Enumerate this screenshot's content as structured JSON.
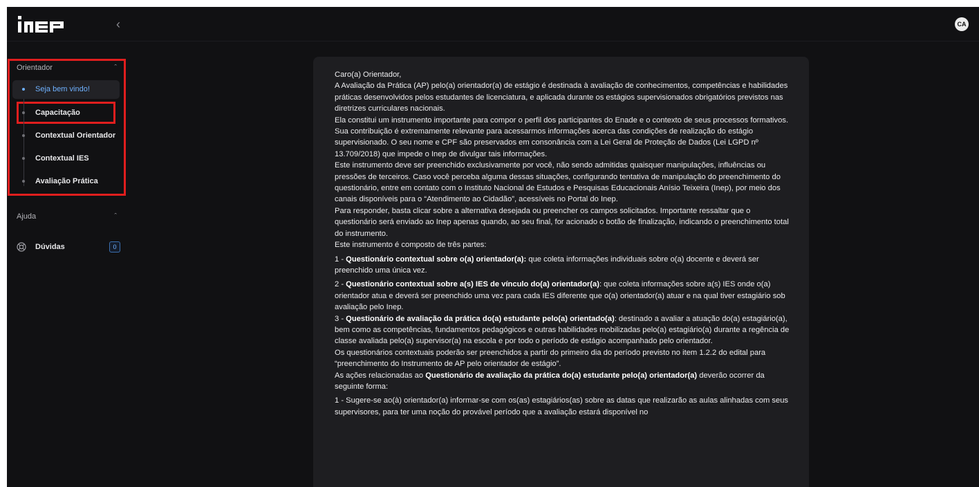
{
  "header": {
    "logo_text": "inep",
    "avatar_initials": "CA"
  },
  "sidebar": {
    "sections": [
      {
        "title": "Orientador",
        "items": [
          {
            "label": "Seja bem vindo!",
            "active": true
          },
          {
            "label": "Capacitação"
          },
          {
            "label": "Contextual Orientador"
          },
          {
            "label": "Contextual IES"
          },
          {
            "label": "Avaliação Prática"
          }
        ]
      },
      {
        "title": "Ajuda",
        "items": [
          {
            "label": "Dúvidas",
            "badge": "0",
            "icon": "help-circle-icon"
          }
        ]
      }
    ]
  },
  "highlight_color": "#e01e1e",
  "accent_color": "#6fb1ff",
  "content": {
    "greeting": "Caro(a) Orientador,",
    "p1": "A Avaliação da Prática (AP) pelo(a) orientador(a) de estágio é destinada à avaliação de conhecimentos, competências e habilidades práticas desenvolvidos pelos estudantes de licenciatura, e aplicada durante os estágios supervisionados obrigatórios previstos nas diretrizes curriculares nacionais.",
    "p2": "Ela constitui um instrumento importante para compor o perfil dos participantes do Enade e o contexto de seus processos formativos.",
    "p3": "Sua contribuição é extremamente relevante para acessarmos informações acerca das condições de realização do estágio supervisionado. O seu nome e CPF são preservados em consonância com a Lei Geral de Proteção de Dados (Lei LGPD nº 13.709/2018) que impede o Inep de divulgar tais informações.",
    "p4": "Este instrumento deve ser preenchido exclusivamente por você, não sendo admitidas quaisquer manipulações, influências ou pressões de terceiros. Caso você perceba alguma dessas situações, configurando tentativa de manipulação do preenchimento do questionário, entre em contato com o Instituto Nacional de Estudos e Pesquisas Educacionais Anísio Teixeira (Inep), por meio dos canais disponíveis para o “Atendimento ao Cidadão”, acessíveis no Portal do Inep.",
    "p5": "Para responder, basta clicar sobre a alternativa desejada ou preencher os campos solicitados. Importante ressaltar que o questionário será enviado ao Inep apenas quando, ao seu final, for acionado o botão de finalização, indicando o preenchimento total do instrumento.",
    "p6": "Este instrumento é composto de três partes:",
    "part1_prefix": "1 - ",
    "part1_bold": "Questionário contextual sobre o(a) orientador(a):",
    "part1_text": " que coleta informações individuais sobre o(a) docente e deverá ser preenchido uma única vez.",
    "part2_prefix": "2 - ",
    "part2_bold": "Questionário contextual sobre a(s) IES de vínculo do(a) orientador(a)",
    "part2_text": ": que coleta informações sobre a(s) IES onde o(a) orientador atua e deverá ser preenchido uma vez para cada IES diferente que o(a) orientador(a) atuar e na qual tiver estagiário sob avaliação pelo Inep.",
    "part3_prefix": "3 - ",
    "part3_bold": "Questionário de avaliação da prática do(a) estudante pelo(a) orientado(a)",
    "part3_text": ": destinado a avaliar a atuação do(a) estagiário(a), bem como as competências, fundamentos pedagógicos e outras habilidades mobilizadas pelo(a) estagiário(a) durante a regência de classe avaliada pelo(a) supervisor(a) na escola e por todo o período de estágio acompanhado pelo orientador.",
    "p7": "Os questionários contextuais poderão ser preenchidos a partir do primeiro dia do período previsto no item 1.2.2 do edital para “preenchimento do Instrumento de AP pelo orientador de estágio”.",
    "p8_prefix": "As ações relacionadas ao ",
    "p8_bold": "Questionário de avaliação da prática do(a) estudante pelo(a) orientador(a)",
    "p8_text": " deverão ocorrer da seguinte forma:",
    "step1": "1 - Sugere-se ao(à) orientador(a) informar-se com os(as) estagiários(as) sobre as datas que realizarão as aulas alinhadas com seus supervisores, para ter uma noção do provável período que a avaliação estará disponível no"
  }
}
